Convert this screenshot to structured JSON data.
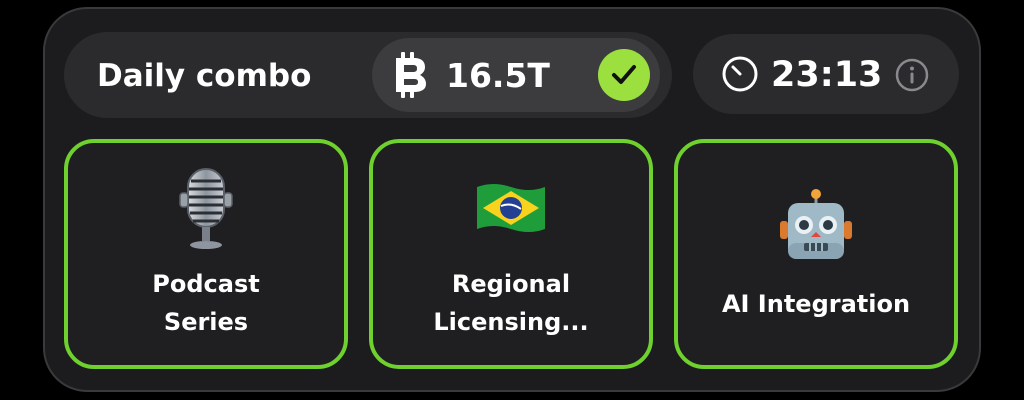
{
  "combo": {
    "title": "Daily combo",
    "reward_amount": "16.5T",
    "coin_icon": "coin-icon",
    "status_icon": "check-icon",
    "accent_color": "#9be03f"
  },
  "timer": {
    "value": "23:13",
    "clock_icon": "clock-icon",
    "info_icon": "info-icon"
  },
  "cards": [
    {
      "icon": "microphone-icon",
      "label_lines": [
        "Podcast",
        "Series"
      ]
    },
    {
      "icon": "brazil-flag-icon",
      "label_lines": [
        "Regional",
        "Licensing..."
      ]
    },
    {
      "icon": "robot-icon",
      "label_lines": [
        "AI Integration"
      ]
    }
  ],
  "colors": {
    "card_border": "#6ed12e",
    "panel_background": "#1c1c1e",
    "pill_background": "#2b2b2e"
  }
}
